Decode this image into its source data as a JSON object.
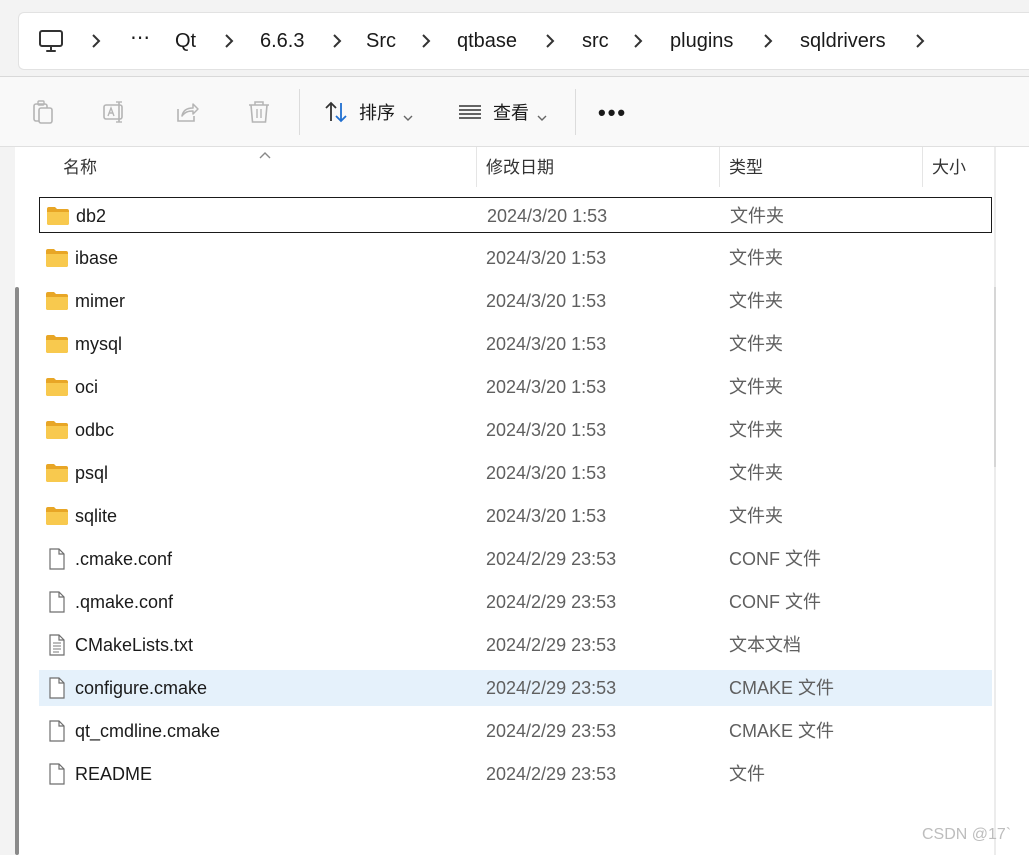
{
  "breadcrumb": {
    "pc_icon": "computer-icon",
    "ellipsis": "⋯",
    "items": [
      "Qt",
      "6.6.3",
      "Src",
      "qtbase",
      "src",
      "plugins",
      "sqldrivers"
    ]
  },
  "toolbar": {
    "sort_label": "排序",
    "view_label": "查看",
    "more": "•••",
    "icons": [
      "copy-icon",
      "rename-icon",
      "share-icon",
      "delete-icon"
    ]
  },
  "columns": {
    "name": "名称",
    "date": "修改日期",
    "type": "类型",
    "size": "大小"
  },
  "files": [
    {
      "name": "db2",
      "date": "2024/3/20 1:53",
      "type": "文件夹",
      "kind": "folder"
    },
    {
      "name": "ibase",
      "date": "2024/3/20 1:53",
      "type": "文件夹",
      "kind": "folder"
    },
    {
      "name": "mimer",
      "date": "2024/3/20 1:53",
      "type": "文件夹",
      "kind": "folder"
    },
    {
      "name": "mysql",
      "date": "2024/3/20 1:53",
      "type": "文件夹",
      "kind": "folder"
    },
    {
      "name": "oci",
      "date": "2024/3/20 1:53",
      "type": "文件夹",
      "kind": "folder"
    },
    {
      "name": "odbc",
      "date": "2024/3/20 1:53",
      "type": "文件夹",
      "kind": "folder"
    },
    {
      "name": "psql",
      "date": "2024/3/20 1:53",
      "type": "文件夹",
      "kind": "folder"
    },
    {
      "name": "sqlite",
      "date": "2024/3/20 1:53",
      "type": "文件夹",
      "kind": "folder"
    },
    {
      "name": ".cmake.conf",
      "date": "2024/2/29 23:53",
      "type": "CONF 文件",
      "kind": "file"
    },
    {
      "name": ".qmake.conf",
      "date": "2024/2/29 23:53",
      "type": "CONF 文件",
      "kind": "file"
    },
    {
      "name": "CMakeLists.txt",
      "date": "2024/2/29 23:53",
      "type": "文本文档",
      "kind": "text"
    },
    {
      "name": "configure.cmake",
      "date": "2024/2/29 23:53",
      "type": "CMAKE 文件",
      "kind": "file"
    },
    {
      "name": "qt_cmdline.cmake",
      "date": "2024/2/29 23:53",
      "type": "CMAKE 文件",
      "kind": "file"
    },
    {
      "name": "README",
      "date": "2024/2/29 23:53",
      "type": "文件",
      "kind": "file"
    }
  ],
  "watermark": "CSDN @17`",
  "colors": {
    "folder": "#f8c94e",
    "hover_row": "#e5f1fb",
    "focus_border": "#1a1a1a"
  }
}
